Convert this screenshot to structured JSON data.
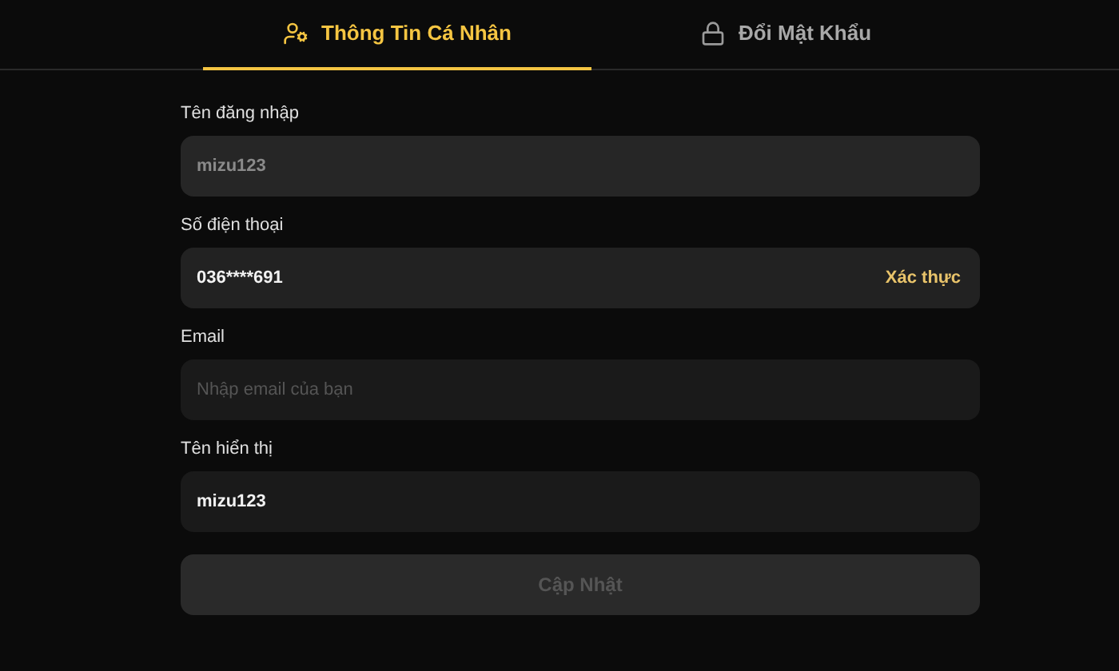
{
  "tabs": [
    {
      "label": "Thông Tin Cá Nhân",
      "kind": "profile",
      "selected": true
    },
    {
      "label": "Đổi Mật Khẩu",
      "kind": "password",
      "selected": false
    }
  ],
  "fields": [
    {
      "label": "Tên đăng nhập",
      "value": "mizu123",
      "disabled": true
    },
    {
      "label": "Số điện thoại",
      "value": "036****691",
      "disabled": false,
      "action": "Xác thực"
    },
    {
      "label": "Email",
      "placeholder": "Nhập email của bạn",
      "disabled": false
    },
    {
      "label": "Tên hiển thị",
      "value": "mizu123",
      "disabled": false
    }
  ],
  "submit": {
    "label": "Cập Nhật",
    "disabled": true
  }
}
